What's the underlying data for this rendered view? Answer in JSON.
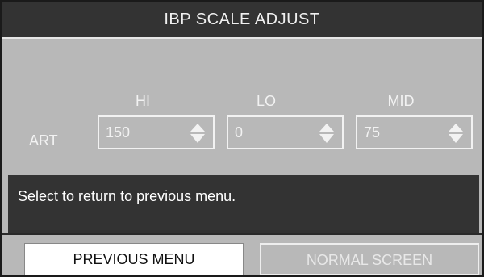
{
  "window": {
    "title": "IBP SCALE ADJUST"
  },
  "scale": {
    "columns": {
      "hi": "HI",
      "lo": "LO",
      "mid": "MID"
    },
    "row_label": "ART",
    "values": {
      "hi": "150",
      "lo": "0",
      "mid": "75"
    }
  },
  "message": {
    "text": "Select to return to previous menu."
  },
  "buttons": {
    "previous_menu": "PREVIOUS MENU",
    "normal_screen": "NORMAL SCREEN"
  },
  "icons": {
    "stepper": "up-down-arrows-icon"
  },
  "colors": {
    "panel_bg": "#b8b8b8",
    "titlebar_bg": "#333333",
    "message_bg": "#333333",
    "highlight_button_bg": "#ffffff",
    "text_light": "#f2f2f2"
  }
}
